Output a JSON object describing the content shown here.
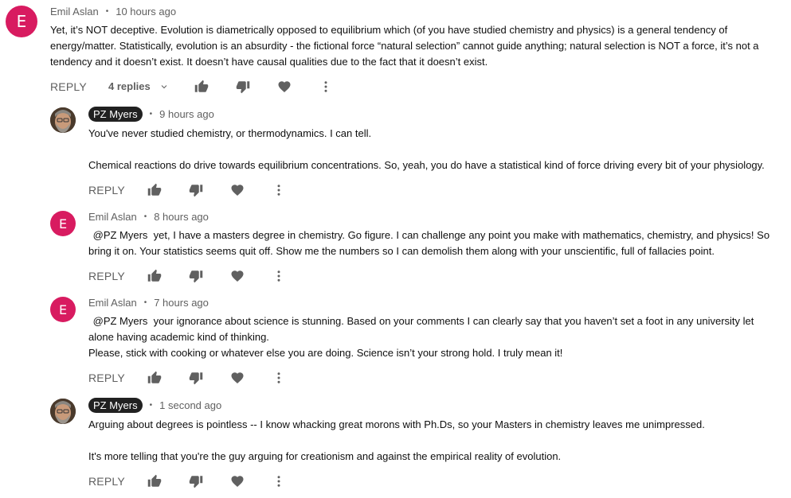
{
  "comments": [
    {
      "author": "Emil Aslan",
      "avatar_letter": "E",
      "time": "10 hours ago",
      "paragraphs": [
        "Yet, it’s NOT deceptive. Evolution is diametrically opposed to equilibrium which (of you have studied chemistry and physics) is a general tendency of energy/matter. Statistically, evolution is an absurdity - the fictional force “natural selection” cannot guide anything; natural selection is NOT a force, it’s not a tendency and it doesn’t exist. It doesn’t have causal qualities due to the fact that it doesn’t exist."
      ],
      "reply_label": "REPLY",
      "replies_label": "4 replies"
    },
    {
      "author": "PZ Myers",
      "time": "9 hours ago",
      "paragraphs": [
        "You've never studied chemistry, or thermodynamics. I can tell.",
        "Chemical reactions do drive towards equilibrium concentrations. So, yeah, you do have a statistical kind of force driving every bit of your physiology."
      ],
      "reply_label": "REPLY"
    },
    {
      "author": "Emil Aslan",
      "avatar_letter": "E",
      "time": "8 hours ago",
      "mention": "@PZ Myers",
      "paragraphs": [
        "yet, I have a masters degree in chemistry. Go figure. I can challenge any point you make with mathematics, chemistry, and physics! So bring it on. Your statistics seems quit off. Show me the numbers so I can demolish them along with your unscientific, full of fallacies point."
      ],
      "reply_label": "REPLY"
    },
    {
      "author": "Emil Aslan",
      "avatar_letter": "E",
      "time": "7 hours ago",
      "mention": "@PZ Myers",
      "paragraphs": [
        "your ignorance about science is stunning. Based on your comments I can clearly say that you haven’t set a foot in any university let alone having academic kind of thinking.",
        "Please, stick with cooking or whatever else you are doing. Science isn’t your strong hold. I truly mean it!"
      ],
      "reply_label": "REPLY"
    },
    {
      "author": "PZ Myers",
      "time": "1 second ago",
      "paragraphs": [
        "Arguing about degrees is pointless -- I know whacking great morons with Ph.Ds, so your Masters in chemistry leaves me unimpressed.",
        "It's more telling that you're the guy arguing for creationism and against the empirical reality of evolution."
      ],
      "reply_label": "REPLY"
    }
  ],
  "icons": {
    "like": "thumb-up-icon",
    "dislike": "thumb-down-icon",
    "heart": "heart-icon",
    "more": "more-vert-icon",
    "expand": "chevron-down-icon"
  },
  "colors": {
    "avatar": "#d81b60",
    "author_badge": "#212121",
    "meta": "#606060",
    "text": "#0f0f0f"
  }
}
